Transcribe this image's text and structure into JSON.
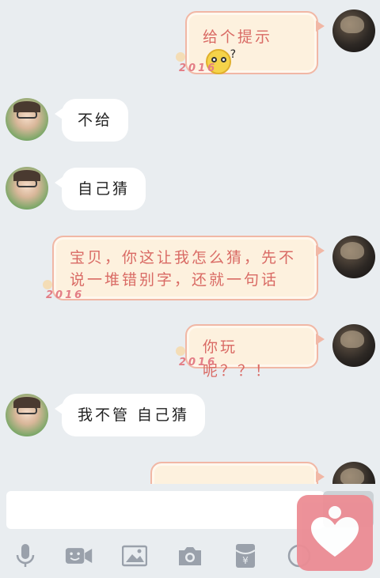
{
  "messages": [
    {
      "side": "me",
      "text": "给个提示",
      "stamp": "2016",
      "emoji": "confused-face"
    },
    {
      "side": "other",
      "text": "不给"
    },
    {
      "side": "other",
      "text": "自己猜"
    },
    {
      "side": "me",
      "line1": "宝贝，你这让我怎么猜，先不",
      "line2": "说一堆错别字，还就一句话",
      "stamp": "2016"
    },
    {
      "side": "me",
      "text": "你玩呢？？！",
      "stamp": "2016"
    },
    {
      "side": "other",
      "text": "我不管  自己猜"
    }
  ],
  "emoji": {
    "question_mark": "?"
  },
  "input": {
    "placeholder": ""
  },
  "toolbar": {
    "icons": [
      "microphone-icon",
      "video-chat-icon",
      "image-icon",
      "camera-icon",
      "red-packet-icon",
      "emoji-icon"
    ]
  },
  "colors": {
    "background": "#e9edf0",
    "bubble_me_text": "#d96a64",
    "favorite_button": "#ec8c94"
  }
}
